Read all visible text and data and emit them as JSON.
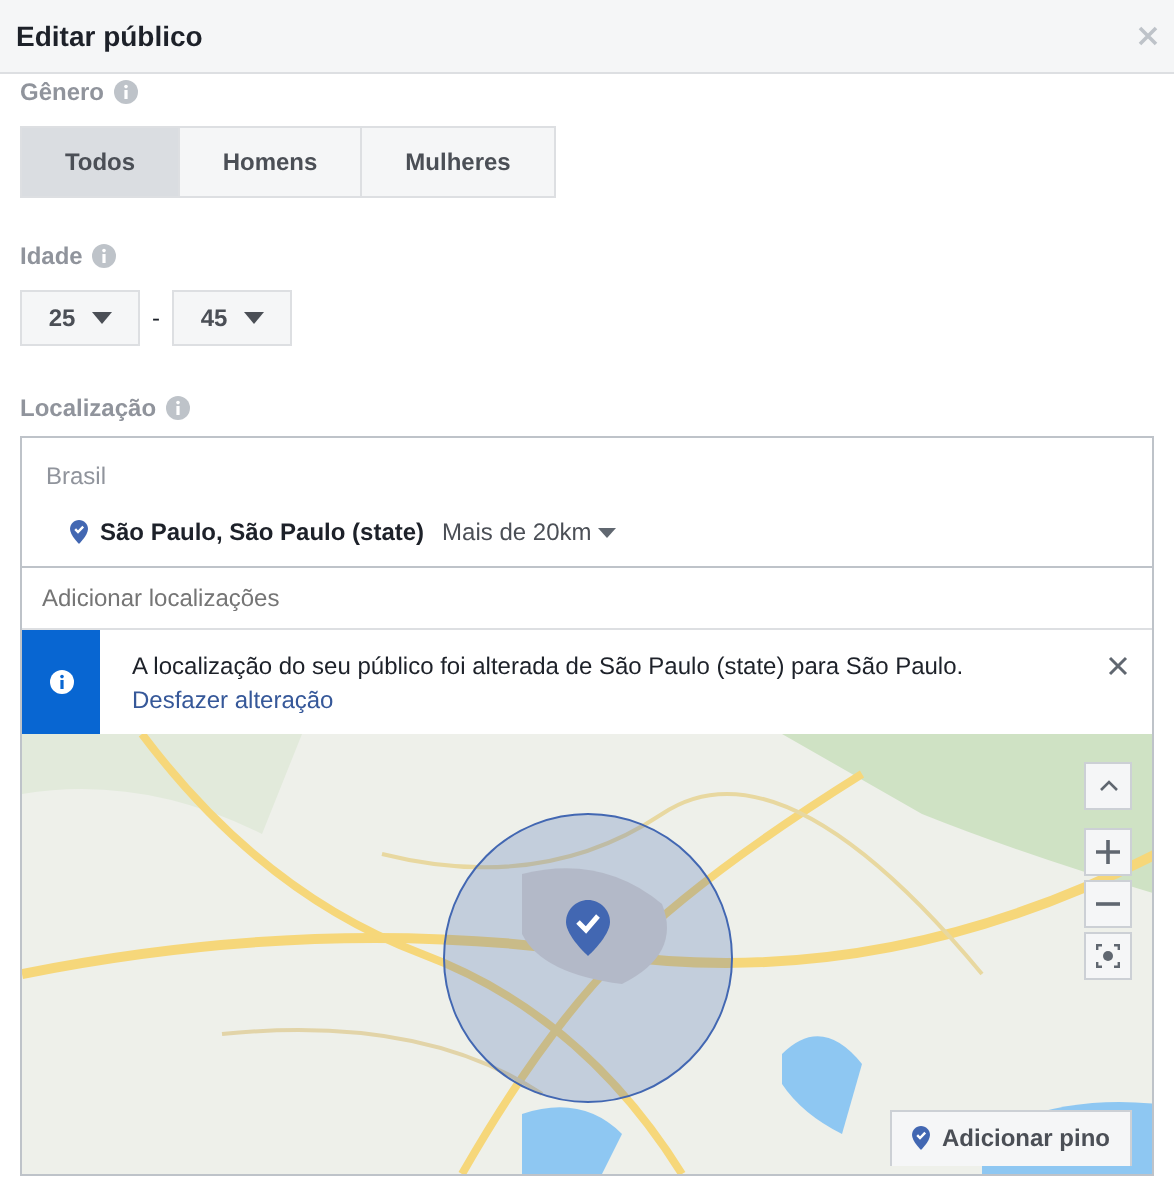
{
  "dialog": {
    "title": "Editar público"
  },
  "gender": {
    "label": "Gênero",
    "options": [
      {
        "label": "Todos",
        "selected": true
      },
      {
        "label": "Homens",
        "selected": false
      },
      {
        "label": "Mulheres",
        "selected": false
      }
    ]
  },
  "age": {
    "label": "Idade",
    "min": "25",
    "separator": "-",
    "max": "45"
  },
  "location": {
    "label": "Localização",
    "country": "Brasil",
    "places": [
      {
        "name": "São Paulo, São Paulo (state)",
        "radius": "Mais de 20km"
      }
    ],
    "placeholder": "Adicionar localizações",
    "notice": {
      "text": "A localização do seu público foi alterada de São Paulo (state) para São Paulo.",
      "link": "Desfazer alteração"
    },
    "map": {
      "kind": "picture",
      "add_pin": "Adicionar pino"
    }
  }
}
